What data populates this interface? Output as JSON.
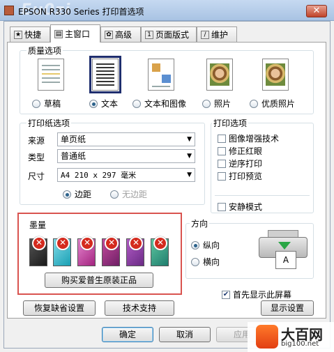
{
  "window": {
    "title": "EPSON R330 Series 打印首选项",
    "watermark": "Eu0zi",
    "close_glyph": "✕"
  },
  "tabs": [
    {
      "label": "快捷",
      "icon": "star-icon"
    },
    {
      "label": "主窗口",
      "icon": "printer-icon",
      "active": true
    },
    {
      "label": "高级",
      "icon": "gear-icon"
    },
    {
      "label": "页面版式",
      "icon": "page-icon"
    },
    {
      "label": "维护",
      "icon": "wrench-icon"
    }
  ],
  "quality": {
    "label": "质量选项",
    "options": [
      {
        "label": "草稿",
        "selected": false
      },
      {
        "label": "文本",
        "selected": true
      },
      {
        "label": "文本和图像",
        "selected": false
      },
      {
        "label": "照片",
        "selected": false
      },
      {
        "label": "优质照片",
        "selected": false
      }
    ]
  },
  "paper": {
    "label": "打印纸选项",
    "source_label": "来源",
    "source_value": "单页纸",
    "type_label": "类型",
    "type_value": "普通纸",
    "size_label": "尺寸",
    "size_value": "A4 210 x 297 毫米",
    "margin_label": "边距",
    "borderless_label": "无边距"
  },
  "print_options": {
    "label": "打印选项",
    "items": [
      {
        "label": "图像增强技术",
        "checked": false
      },
      {
        "label": "修正红眼",
        "checked": false
      },
      {
        "label": "逆序打印",
        "checked": false
      },
      {
        "label": "打印预览",
        "checked": false
      }
    ],
    "quiet_mode_label": "安静模式",
    "quiet_mode_checked": false
  },
  "ink": {
    "label": "墨量",
    "cartridges": [
      {
        "color": "#2b2b2b",
        "status": "error"
      },
      {
        "color": "#27b5c9",
        "status": "error"
      },
      {
        "color": "#c23aa0",
        "status": "error"
      },
      {
        "color": "#e6d12a",
        "status": "error"
      },
      {
        "color": "#8fd4ec",
        "status": "error"
      },
      {
        "color": "#e58ec8",
        "status": "error"
      }
    ],
    "error_glyph": "✕",
    "buy_label": "购买爱普生原装正品"
  },
  "orientation": {
    "label": "方向",
    "portrait_label": "纵向",
    "landscape_label": "横向",
    "selected": "portrait",
    "paper_glyph": "A"
  },
  "show_screen_first": {
    "label": "首先显示此屏幕",
    "checked": true
  },
  "buttons": {
    "restore_defaults": "恢复缺省设置",
    "tech_support": "技术支持",
    "show_settings": "显示设置",
    "ok": "确定",
    "cancel": "取消",
    "apply": "应用"
  },
  "logo": {
    "text": "大百网",
    "url": "big100.net"
  }
}
